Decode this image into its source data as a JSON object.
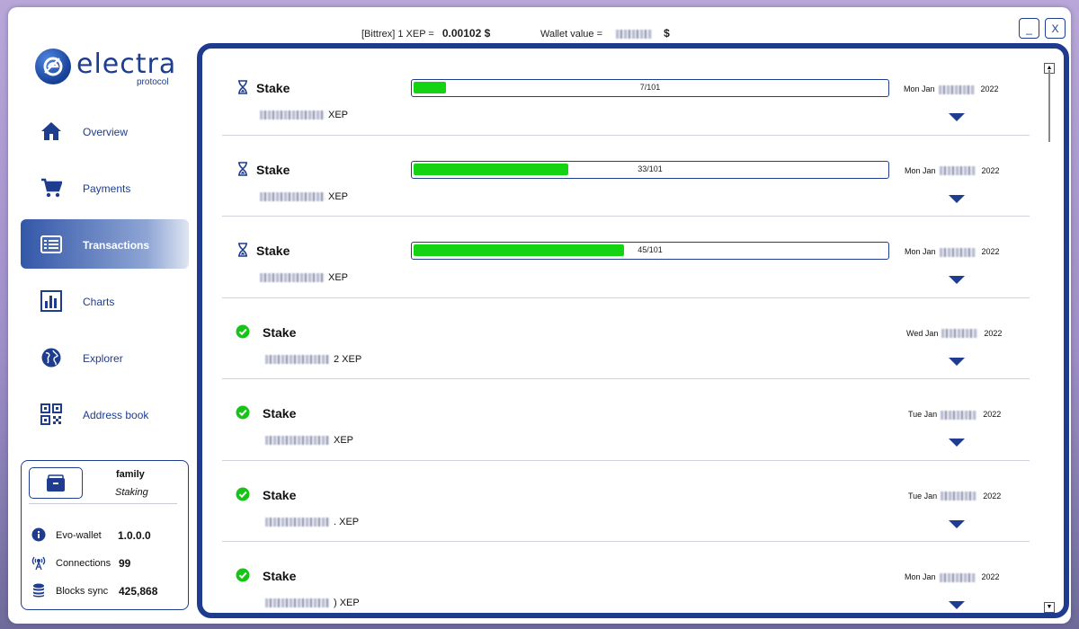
{
  "header": {
    "price_label": "[Bittrex] 1 XEP =",
    "price_value": "0.00102 $",
    "wallet_label": "Wallet value =",
    "wallet_unit": "$",
    "minimize": "_",
    "close": "X"
  },
  "logo": {
    "word": "electra",
    "sub": "protocol"
  },
  "nav": {
    "overview": "Overview",
    "payments": "Payments",
    "transactions": "Transactions",
    "charts": "Charts",
    "explorer": "Explorer",
    "address_book": "Address book"
  },
  "wallet_box": {
    "name": "family",
    "state": "Staking",
    "evo_label": "Evo-wallet",
    "evo_value": "1.0.0.0",
    "connections_label": "Connections",
    "connections_value": "99",
    "blocks_label": "Blocks sync",
    "blocks_value": "425,868"
  },
  "transactions": [
    {
      "type": "Stake",
      "status": "pending",
      "currency": "XEP",
      "progress_text": "7/101",
      "progress": 0.069,
      "day": "Mon Jan",
      "year": "2022"
    },
    {
      "type": "Stake",
      "status": "pending",
      "currency": "XEP",
      "progress_text": "33/101",
      "progress": 0.327,
      "day": "Mon Jan",
      "year": "2022"
    },
    {
      "type": "Stake",
      "status": "pending",
      "currency": "XEP",
      "progress_text": "45/101",
      "progress": 0.446,
      "day": "Mon Jan",
      "year": "2022"
    },
    {
      "type": "Stake",
      "status": "confirmed",
      "currency": "2 XEP",
      "day": "Wed Jan",
      "year": "2022"
    },
    {
      "type": "Stake",
      "status": "confirmed",
      "currency": "XEP",
      "day": "Tue Jan",
      "year": "2022"
    },
    {
      "type": "Stake",
      "status": "confirmed",
      "currency": ". XEP",
      "day": "Tue Jan",
      "year": "2022"
    },
    {
      "type": "Stake",
      "status": "confirmed",
      "currency": ") XEP",
      "day": "Mon Jan",
      "year": "2022"
    }
  ],
  "colors": {
    "accent": "#1e3d8f",
    "progress": "#13d313",
    "confirmed": "#17c317"
  }
}
